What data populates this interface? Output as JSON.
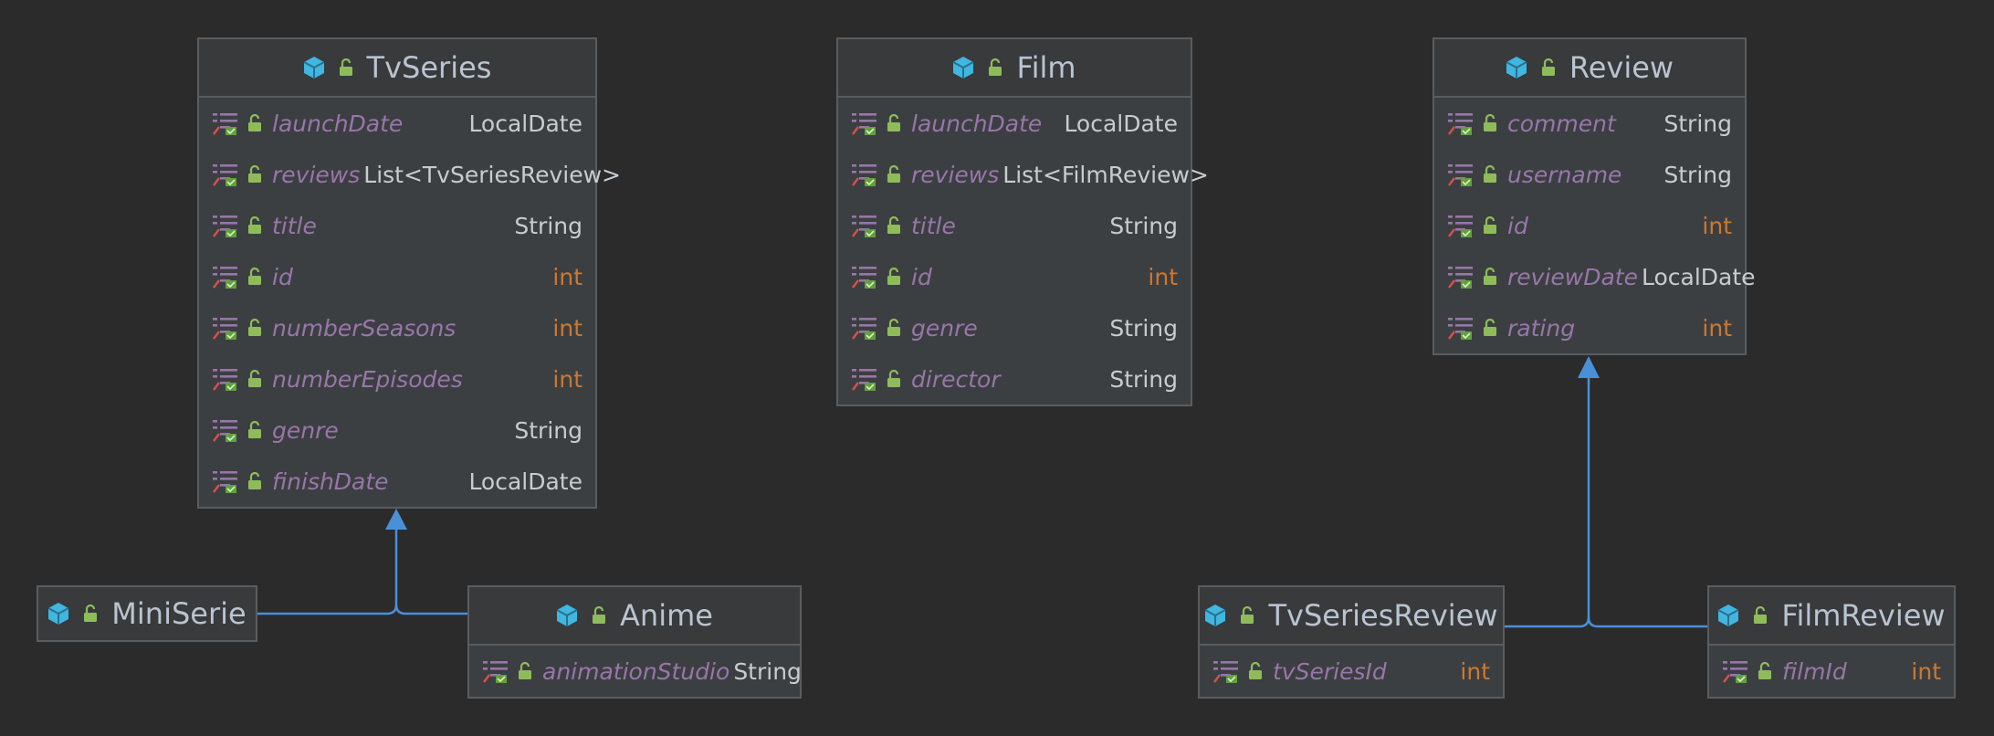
{
  "colors": {
    "background": "#2b2b2b",
    "box_fill": "#3c3f41",
    "box_border": "#5a5d5f",
    "class_name": "#b9c4d0",
    "field_name": "#9876aa",
    "type_reference": "#c7ccd1",
    "type_primitive": "#cc7832",
    "class_icon": "#40b6e0",
    "lock_icon": "#8fbc5a",
    "arrow": "#4a90d9"
  },
  "icons": {
    "class": "class-cube-icon",
    "visibility": "open-lock-icon",
    "field": "field-list-icon"
  },
  "classes": {
    "tvseries": {
      "name": "TvSeries",
      "fields": [
        {
          "name": "launchDate",
          "type": "LocalDate",
          "kind": "ref"
        },
        {
          "name": "reviews",
          "type": "List<TvSeriesReview>",
          "kind": "ref"
        },
        {
          "name": "title",
          "type": "String",
          "kind": "ref"
        },
        {
          "name": "id",
          "type": "int",
          "kind": "prim"
        },
        {
          "name": "numberSeasons",
          "type": "int",
          "kind": "prim"
        },
        {
          "name": "numberEpisodes",
          "type": "int",
          "kind": "prim"
        },
        {
          "name": "genre",
          "type": "String",
          "kind": "ref"
        },
        {
          "name": "finishDate",
          "type": "LocalDate",
          "kind": "ref"
        }
      ]
    },
    "film": {
      "name": "Film",
      "fields": [
        {
          "name": "launchDate",
          "type": "LocalDate",
          "kind": "ref"
        },
        {
          "name": "reviews",
          "type": "List<FilmReview>",
          "kind": "ref"
        },
        {
          "name": "title",
          "type": "String",
          "kind": "ref"
        },
        {
          "name": "id",
          "type": "int",
          "kind": "prim"
        },
        {
          "name": "genre",
          "type": "String",
          "kind": "ref"
        },
        {
          "name": "director",
          "type": "String",
          "kind": "ref"
        }
      ]
    },
    "review": {
      "name": "Review",
      "fields": [
        {
          "name": "comment",
          "type": "String",
          "kind": "ref"
        },
        {
          "name": "username",
          "type": "String",
          "kind": "ref"
        },
        {
          "name": "id",
          "type": "int",
          "kind": "prim"
        },
        {
          "name": "reviewDate",
          "type": "LocalDate",
          "kind": "ref"
        },
        {
          "name": "rating",
          "type": "int",
          "kind": "prim"
        }
      ]
    },
    "miniserie": {
      "name": "MiniSerie",
      "fields": []
    },
    "anime": {
      "name": "Anime",
      "fields": [
        {
          "name": "animationStudio",
          "type": "String",
          "kind": "ref"
        }
      ]
    },
    "tvseriesreview": {
      "name": "TvSeriesReview",
      "fields": [
        {
          "name": "tvSeriesId",
          "type": "int",
          "kind": "prim"
        }
      ]
    },
    "filmreview": {
      "name": "FilmReview",
      "fields": [
        {
          "name": "filmId",
          "type": "int",
          "kind": "prim"
        }
      ]
    }
  },
  "relations": [
    {
      "from": "MiniSerie",
      "to": "TvSeries",
      "type": "extends"
    },
    {
      "from": "Anime",
      "to": "TvSeries",
      "type": "extends"
    },
    {
      "from": "TvSeriesReview",
      "to": "Review",
      "type": "extends"
    },
    {
      "from": "FilmReview",
      "to": "Review",
      "type": "extends"
    }
  ]
}
